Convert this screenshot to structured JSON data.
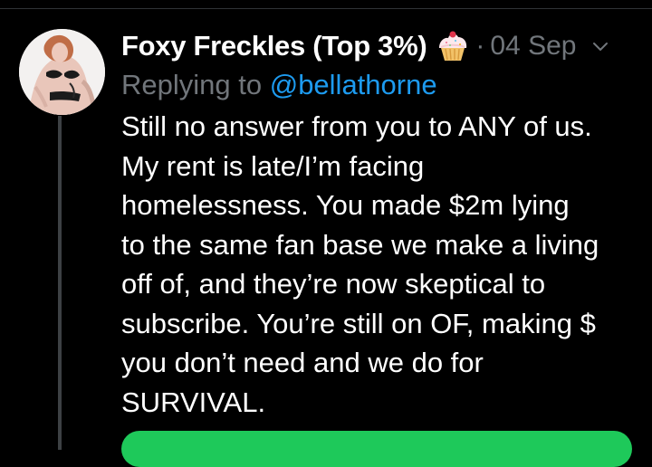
{
  "tweet": {
    "display_name": "Foxy Freckles (Top 3%)",
    "emoji": "cupcake-emoji",
    "separator": "·",
    "timestamp": "04 Sep",
    "replying_to_prefix": "Replying to ",
    "replying_to_handle": "@bellathorne",
    "text_lines": [
      "Still no answer from you to ANY of us.",
      "My rent is late/I’m facing",
      "homelessness. You made $2m lying",
      "to the same fan base we make a living",
      "off of, and they’re now skeptical to",
      "subscribe. You’re still on OF, making $",
      "you don’t need and we do for",
      "SURVIVAL."
    ]
  },
  "icons": {
    "emoji": "cupcake-icon",
    "menu": "chevron-down-icon",
    "avatar": "avatar-photo"
  },
  "colors": {
    "background": "#000000",
    "primary_text": "#ffffff",
    "secondary_text": "#71767b",
    "link": "#1d9bf0",
    "thread_line": "#3d4144",
    "button_green": "#1ec95a"
  }
}
